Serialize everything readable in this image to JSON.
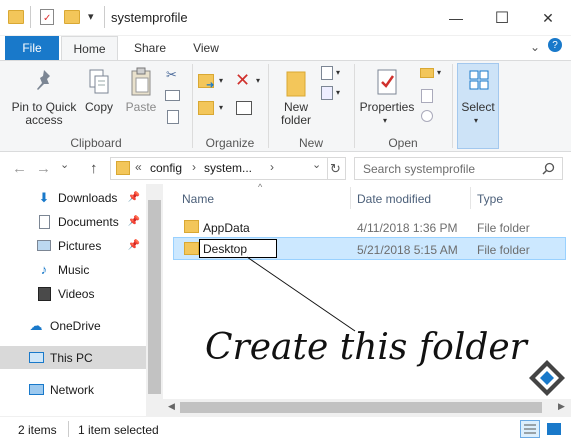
{
  "window": {
    "title": "systemprofile",
    "minimize_glyph": "—",
    "maximize_glyph": "☐",
    "close_glyph": "✕"
  },
  "ribbon_tabs": {
    "file": "File",
    "home": "Home",
    "share": "Share",
    "view": "View",
    "expand_glyph": "⌄",
    "help_glyph": "?"
  },
  "clipboard": {
    "pin_label": "Pin to Quick access",
    "copy_label": "Copy",
    "paste_label": "Paste",
    "group_label": "Clipboard"
  },
  "organize": {
    "group_label": "Organize"
  },
  "new_group": {
    "new_folder_label": "New folder",
    "group_label": "New"
  },
  "open_group": {
    "properties_label": "Properties",
    "group_label": "Open"
  },
  "select_group": {
    "select_label": "Select"
  },
  "address": {
    "crumbs": [
      "config",
      "system..."
    ],
    "prefix": "«",
    "sep": "›",
    "chevron": "⌄",
    "refresh_glyph": "↻"
  },
  "search": {
    "placeholder": "Search systemprofile"
  },
  "nav": {
    "back": "←",
    "forward": "→",
    "recent": "⌄",
    "up": "↑",
    "items": [
      {
        "label": "Downloads",
        "icon": "download-icon",
        "pinned": true
      },
      {
        "label": "Documents",
        "icon": "document-icon",
        "pinned": true
      },
      {
        "label": "Pictures",
        "icon": "pictures-icon",
        "pinned": true
      },
      {
        "label": "Music",
        "icon": "music-icon",
        "pinned": false
      },
      {
        "label": "Videos",
        "icon": "videos-icon",
        "pinned": false
      },
      {
        "label": "OneDrive",
        "icon": "cloud-icon",
        "pinned": false
      },
      {
        "label": "This PC",
        "icon": "computer-icon",
        "pinned": false
      },
      {
        "label": "Network",
        "icon": "network-icon",
        "pinned": false
      }
    ]
  },
  "table": {
    "columns": {
      "name": "Name",
      "date": "Date modified",
      "type": "Type"
    },
    "rows": [
      {
        "name": "AppData",
        "date": "4/11/2018 1:36 PM",
        "type": "File folder"
      },
      {
        "name": "Desktop",
        "date": "5/21/2018 5:15 AM",
        "type": "File folder"
      }
    ]
  },
  "annotation": {
    "text": "Create this folder"
  },
  "status": {
    "items_count": "2 items",
    "selected": "1 item selected"
  },
  "colors": {
    "accent": "#1979ca",
    "selection": "#cce8ff",
    "folder": "#f3c65a"
  }
}
